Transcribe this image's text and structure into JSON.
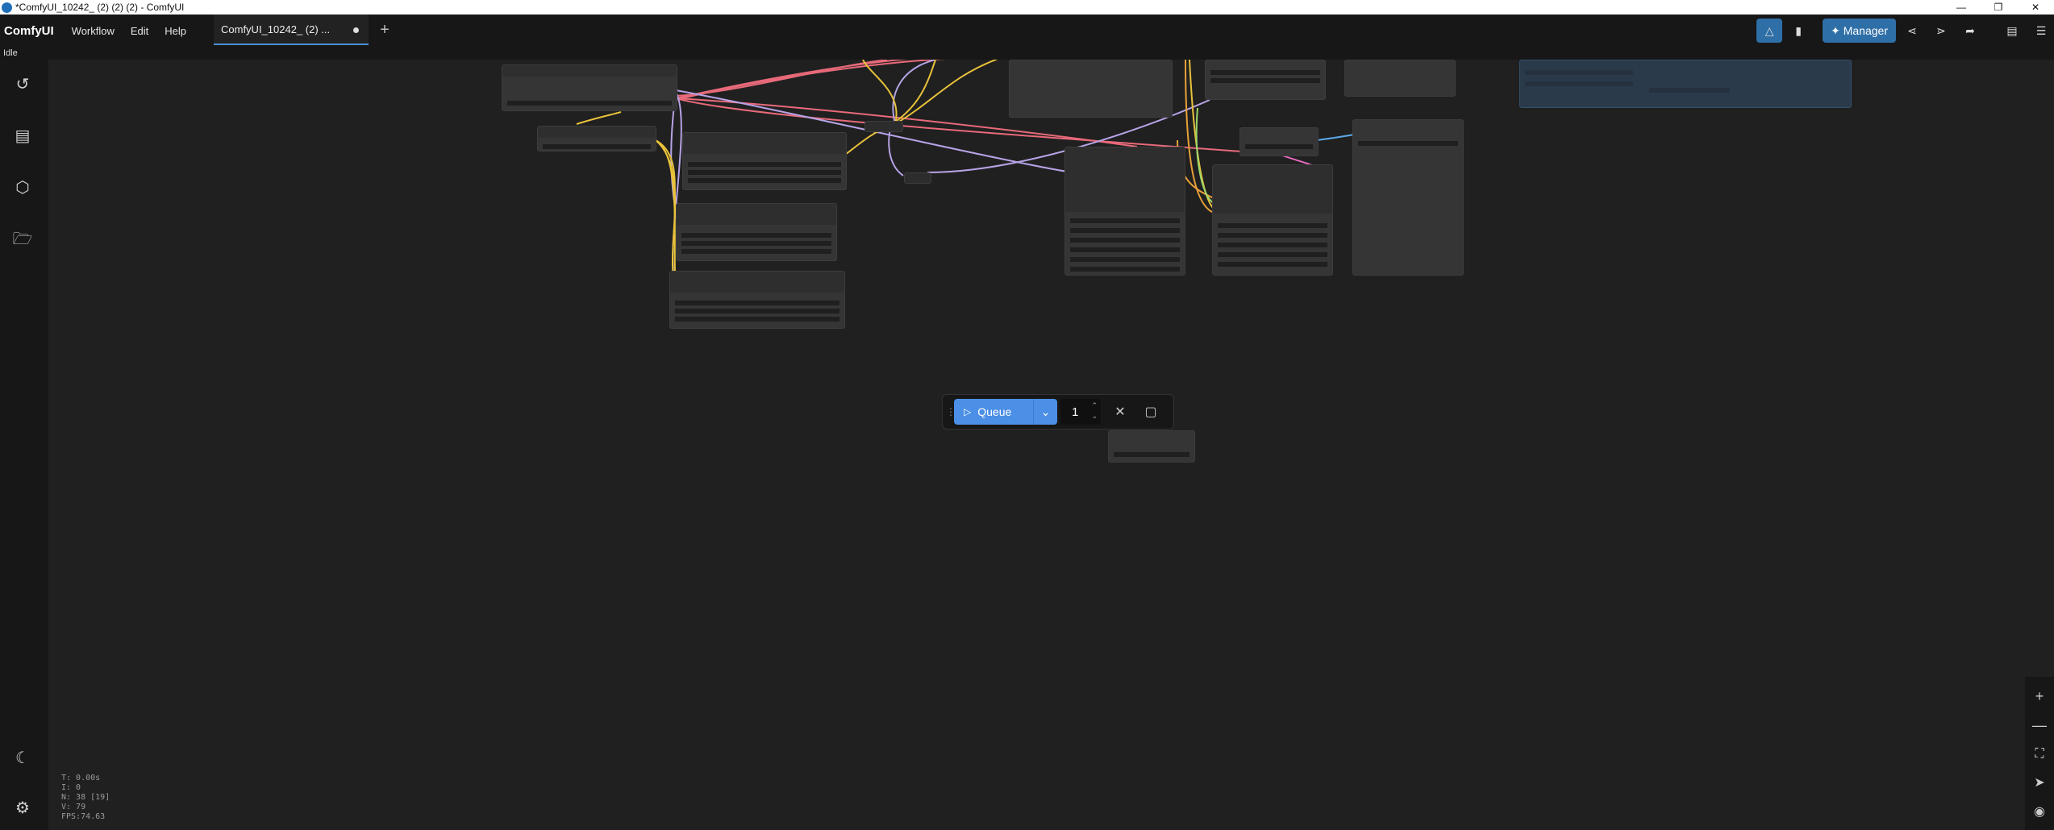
{
  "window": {
    "title": "*ComfyUI_10242_ (2) (2) (2) - ComfyUI",
    "minimize_icon": "minimize-icon",
    "maximize_icon": "restore-icon",
    "close_icon": "close-icon"
  },
  "menubar": {
    "brand": "ComfyUI",
    "items": [
      "Workflow",
      "Edit",
      "Help"
    ],
    "tab_label": "ComfyUI_10242_ (2) ...",
    "manager_label": "Manager"
  },
  "status": {
    "text": "Idle"
  },
  "sidebar": {
    "icons": [
      "history-icon",
      "document-icon",
      "cube-icon",
      "folder-open-icon",
      "moon-icon",
      "gear-icon"
    ]
  },
  "queue": {
    "label": "Queue",
    "count": "1"
  },
  "stats": {
    "t": "T: 0.00s",
    "i": "I: 0",
    "n": "N: 38 [19]",
    "v": "V: 79",
    "fps": "FPS:74.63"
  },
  "colors": {
    "accent": "#4c8fe6",
    "link_pink": "#e86a7a",
    "link_purple": "#b7a3e6",
    "link_yellow": "#e8c23a",
    "link_blue": "#5aa7e6"
  }
}
